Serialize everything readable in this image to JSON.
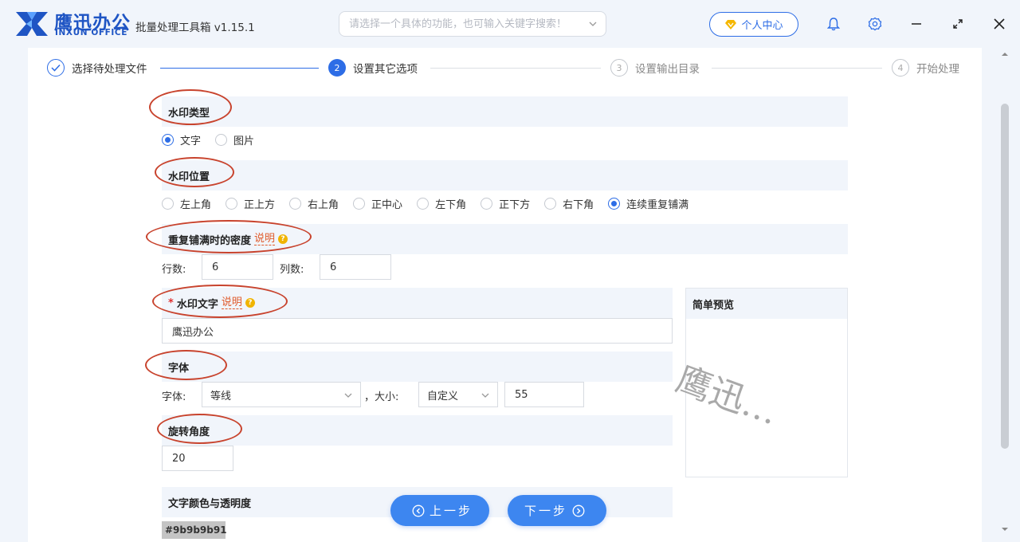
{
  "app": {
    "logo_cn": "鹰迅办公",
    "logo_en": "INXUN OFFICE",
    "title": "批量处理工具箱 v1.15.1"
  },
  "header": {
    "search_placeholder": "请选择一个具体的功能，也可输入关键字搜索！",
    "user_center_label": "个人中心",
    "icons": [
      "bell-icon",
      "gear-icon",
      "minimize-icon",
      "maximize-icon",
      "close-icon"
    ]
  },
  "steps": [
    {
      "num": "✓",
      "label": "选择待处理文件",
      "state": "done"
    },
    {
      "num": "2",
      "label": "设置其它选项",
      "state": "active"
    },
    {
      "num": "3",
      "label": "设置输出目录",
      "state": "pending"
    },
    {
      "num": "4",
      "label": "开始处理",
      "state": "pending"
    }
  ],
  "watermark_type": {
    "title": "水印类型",
    "options": [
      "文字",
      "图片"
    ],
    "selected": "文字"
  },
  "watermark_position": {
    "title": "水印位置",
    "options": [
      "左上角",
      "正上方",
      "右上角",
      "正中心",
      "左下角",
      "正下方",
      "右下角",
      "连续重复铺满"
    ],
    "selected": "连续重复铺满"
  },
  "density": {
    "title": "重复铺满时的密度",
    "hint": "说明",
    "rows_label": "行数:",
    "rows_value": "6",
    "cols_label": "列数:",
    "cols_value": "6"
  },
  "watermark_text": {
    "required_mark": "*",
    "title": "水印文字",
    "hint": "说明",
    "value": "鹰迅办公"
  },
  "font": {
    "title": "字体",
    "font_label": "字体:",
    "font_value": "等线",
    "size_label": "，大小:",
    "size_mode": "自定义",
    "size_value": "55"
  },
  "rotation": {
    "title": "旋转角度",
    "value": "20"
  },
  "color": {
    "title": "文字颜色与透明度",
    "value": "#9b9b9b91"
  },
  "preview": {
    "title": "简单预览",
    "text": "鹰迅…"
  },
  "buttons": {
    "prev": "上一步",
    "next": "下一步"
  },
  "colors": {
    "accent": "#2d6de6",
    "annotation": "#c8432d",
    "section_bg": "#f1f5fb"
  }
}
